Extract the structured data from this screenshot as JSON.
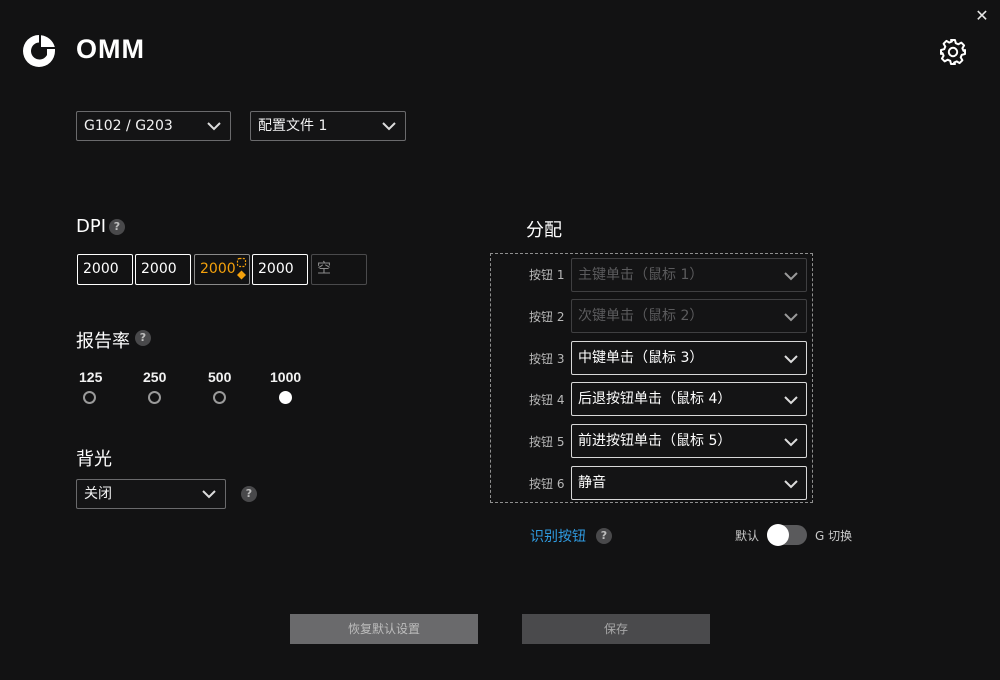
{
  "window": {
    "close_icon": "close-icon",
    "close_glyph": "✕"
  },
  "header": {
    "title": "OMM",
    "logo_icon": "logitech-g-logo",
    "settings_icon": "gear-icon"
  },
  "device_select": {
    "value": "G102 / G203"
  },
  "profile_select": {
    "value": "配置文件 1"
  },
  "dpi": {
    "heading": "DPI",
    "help": "?",
    "levels": [
      "2000",
      "2000",
      "2000",
      "2000",
      "空"
    ],
    "active_index": 2,
    "active_color": "#f4a10c"
  },
  "report_rate": {
    "heading": "报告率",
    "help": "?",
    "options": [
      "125",
      "250",
      "500",
      "1000"
    ],
    "selected": "1000"
  },
  "backlight": {
    "heading": "背光",
    "value": "关闭",
    "help": "?"
  },
  "assignments": {
    "heading": "分配",
    "rows": [
      {
        "label": "按钮 1",
        "value": "主键单击（鼠标 1）",
        "enabled": false
      },
      {
        "label": "按钮 2",
        "value": "次键单击（鼠标 2）",
        "enabled": false
      },
      {
        "label": "按钮 3",
        "value": "中键单击（鼠标 3）",
        "enabled": true
      },
      {
        "label": "按钮 4",
        "value": "后退按钮单击（鼠标 4）",
        "enabled": true
      },
      {
        "label": "按钮 5",
        "value": "前进按钮单击（鼠标 5）",
        "enabled": true
      },
      {
        "label": "按钮 6",
        "value": "静音",
        "enabled": true
      }
    ]
  },
  "identify": {
    "label": "识别按钮",
    "help": "?"
  },
  "gshift": {
    "left_label": "默认",
    "right_label": "G 切换",
    "on": false
  },
  "buttons": {
    "restore": "恢复默认设置",
    "save": "保存"
  },
  "colors": {
    "accent_link": "#2f9be0",
    "background": "#121213"
  }
}
